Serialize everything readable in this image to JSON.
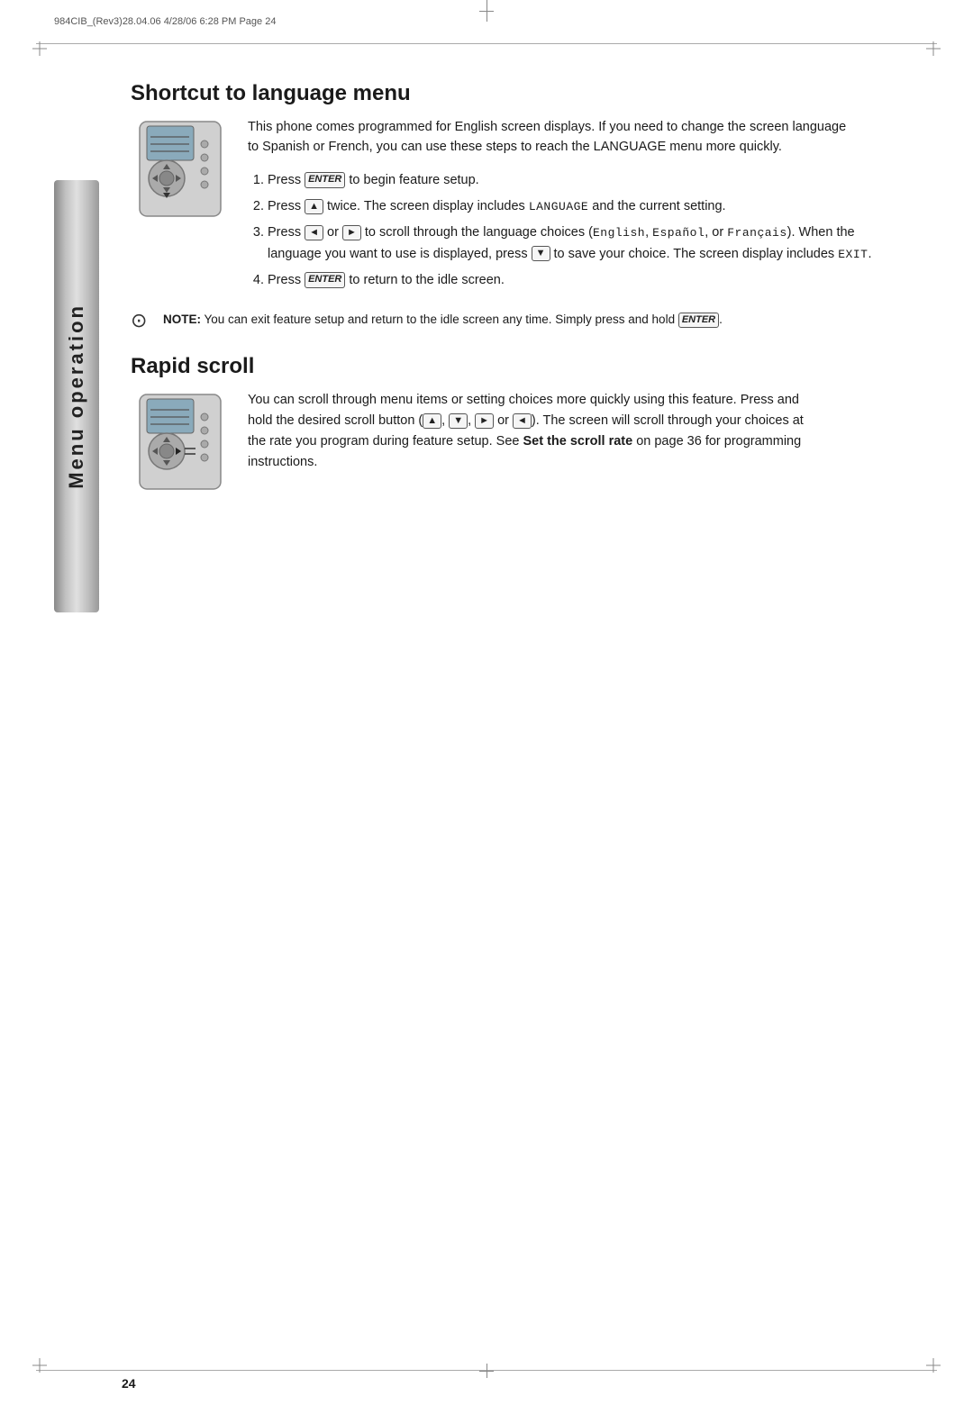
{
  "meta": {
    "header": "984CIB_(Rev3)28.04.06  4/28/06  6:28 PM  Page 24"
  },
  "sidebar": {
    "label": "Menu operation"
  },
  "shortcut_section": {
    "title": "Shortcut to language menu",
    "intro": "This phone comes programmed for English screen displays. If you need to change the screen language to Spanish or French, you can use these steps to reach the LANGUAGE menu more quickly.",
    "steps": [
      {
        "num": "1",
        "parts": [
          {
            "type": "text",
            "value": "Press "
          },
          {
            "type": "key",
            "value": "ENTER"
          },
          {
            "type": "text",
            "value": " to begin feature setup."
          }
        ]
      },
      {
        "num": "2",
        "parts": [
          {
            "type": "text",
            "value": "Press "
          },
          {
            "type": "arrow",
            "value": "▲"
          },
          {
            "type": "text",
            "value": " twice. The screen display includes "
          },
          {
            "type": "mono",
            "value": "LANGUAGE"
          },
          {
            "type": "text",
            "value": " and the current setting."
          }
        ]
      },
      {
        "num": "3",
        "parts": [
          {
            "type": "text",
            "value": "Press "
          },
          {
            "type": "arrow",
            "value": "◄"
          },
          {
            "type": "text",
            "value": " or "
          },
          {
            "type": "arrow",
            "value": "►"
          },
          {
            "type": "text",
            "value": " to scroll through the language choices ("
          },
          {
            "type": "mono",
            "value": "English"
          },
          {
            "type": "text",
            "value": ", "
          },
          {
            "type": "mono",
            "value": "Español"
          },
          {
            "type": "text",
            "value": ", or "
          },
          {
            "type": "mono",
            "value": "Français"
          },
          {
            "type": "text",
            "value": "). When the language you want to use is displayed, press "
          },
          {
            "type": "arrow",
            "value": "▼"
          },
          {
            "type": "text",
            "value": " to save your choice. The screen display includes "
          },
          {
            "type": "mono",
            "value": "EXIT"
          },
          {
            "type": "text",
            "value": "."
          }
        ]
      },
      {
        "num": "4",
        "parts": [
          {
            "type": "text",
            "value": "Press "
          },
          {
            "type": "key",
            "value": "ENTER"
          },
          {
            "type": "text",
            "value": " to return to the idle screen."
          }
        ]
      }
    ],
    "note_label": "NOTE:",
    "note_text": "You can exit feature setup and return to the idle screen any time. Simply press and hold ",
    "note_key": "ENTER",
    "note_end": "."
  },
  "rapid_section": {
    "title": "Rapid scroll",
    "body_start": "You can scroll through menu items or setting choices more quickly using this feature. Press and hold the desired scroll button (",
    "body_arrows": [
      "▲",
      "▼",
      "►",
      "◄"
    ],
    "body_mid": "). The screen will scroll through your choices at the rate you program during feature setup. See ",
    "body_bold": "Set the scroll rate",
    "body_end": " on page 36 for programming instructions."
  },
  "page_number": "24"
}
